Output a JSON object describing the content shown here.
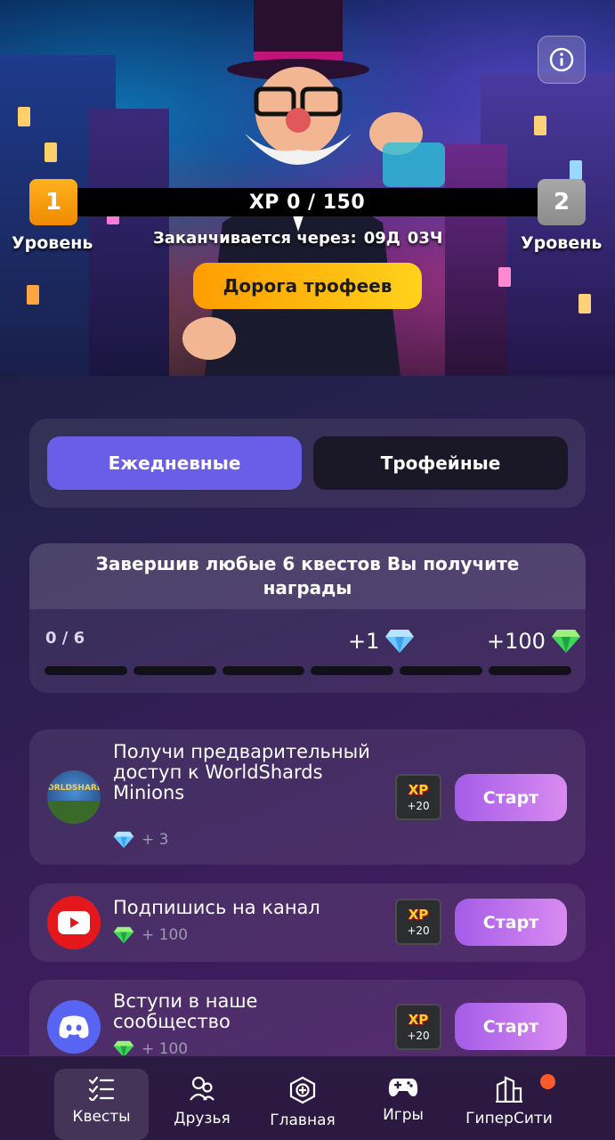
{
  "hero": {
    "level_current": "1",
    "level_next": "2",
    "level_label": "Уровень",
    "xp_text": "XP 0 / 150",
    "ends_label": "Заканчивается через:",
    "ends_days": "09Д",
    "ends_hours": "03Ч",
    "trophy_road_button": "Дорога трофеев",
    "info_icon": "info-icon"
  },
  "tabs": [
    {
      "label": "Ежедневные",
      "active": true
    },
    {
      "label": "Трофейные",
      "active": false
    }
  ],
  "progress": {
    "title": "Завершив любые 6 квестов Вы получите награды",
    "count": "0 / 6",
    "completed": 0,
    "total": 6,
    "reward_1": "+1",
    "reward_1_icon": "blue-diamond-icon",
    "reward_2": "+100",
    "reward_2_icon": "green-gem-icon"
  },
  "quests": [
    {
      "title": "Получи предварительный доступ к WorldShards Minions",
      "reward": "+ 3",
      "reward_icon": "blue-diamond-icon",
      "xp_label": "XP",
      "xp_amount": "+20",
      "button": "Старт",
      "icon": "worldshards-icon"
    },
    {
      "title": "Подпишись на канал",
      "reward": "+ 100",
      "reward_icon": "green-gem-icon",
      "xp_label": "XP",
      "xp_amount": "+20",
      "button": "Старт",
      "icon": "youtube-icon"
    },
    {
      "title": "Вступи в наше сообщество",
      "reward": "+ 100",
      "reward_icon": "green-gem-icon",
      "xp_label": "XP",
      "xp_amount": "+20",
      "button": "Старт",
      "icon": "discord-icon"
    }
  ],
  "nav": [
    {
      "label": "Квесты",
      "icon": "quests-icon",
      "active": true
    },
    {
      "label": "Друзья",
      "icon": "friends-icon",
      "active": false
    },
    {
      "label": "Главная",
      "icon": "home-icon",
      "active": false
    },
    {
      "label": "Игры",
      "icon": "gamepad-icon",
      "active": false
    },
    {
      "label": "ГиперСити",
      "icon": "city-icon",
      "active": false,
      "notification": true
    }
  ],
  "colors": {
    "accent": "#6a5ee8",
    "start_button": "#b86ce9",
    "trophy_button": "#ffb60d",
    "level_current": "#f8a312",
    "level_next": "#9a9a9a",
    "notification": "#ff5a2a"
  }
}
